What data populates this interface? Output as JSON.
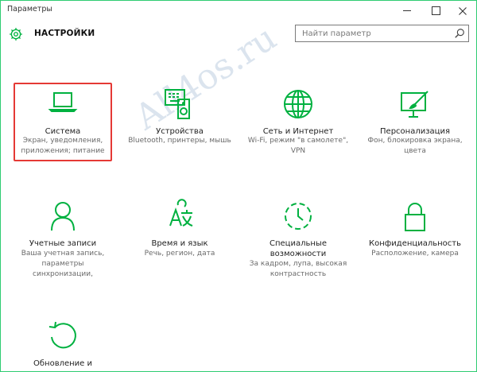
{
  "window": {
    "title": "Параметры"
  },
  "header": {
    "title": "НАСТРОЙКИ",
    "icon": "gear-icon"
  },
  "search": {
    "placeholder": "Найти параметр",
    "icon": "search-icon"
  },
  "accent_color": "#00b140",
  "selection_color": "#e53935",
  "tiles": [
    {
      "id": "system",
      "icon": "laptop-icon",
      "name": "Система",
      "desc": "Экран, уведомления, приложения; питание",
      "selected": true
    },
    {
      "id": "devices",
      "icon": "devices-icon",
      "name": "Устройства",
      "desc": "Bluetooth, принтеры, мышь"
    },
    {
      "id": "network",
      "icon": "globe-icon",
      "name": "Сеть и Интернет",
      "desc": "Wi-Fi, режим \"в самолете\", VPN"
    },
    {
      "id": "personalization",
      "icon": "personalization-icon",
      "name": "Персонализация",
      "desc": "Фон, блокировка экрана, цвета"
    },
    {
      "id": "accounts",
      "icon": "person-icon",
      "name": "Учетные записи",
      "desc": "Ваша учетная запись, параметры синхронизации,"
    },
    {
      "id": "time",
      "icon": "time-language-icon",
      "name": "Время и язык",
      "desc": "Речь, регион, дата"
    },
    {
      "id": "ease",
      "icon": "accessibility-icon",
      "name": "Специальные возможности",
      "desc": "За кадром, лупа, высокая контрастность"
    },
    {
      "id": "privacy",
      "icon": "lock-icon",
      "name": "Конфиденциальность",
      "desc": "Расположение, камера"
    },
    {
      "id": "update",
      "icon": "update-icon",
      "name": "Обновление и",
      "desc": ""
    }
  ],
  "watermark": "All4os.ru"
}
